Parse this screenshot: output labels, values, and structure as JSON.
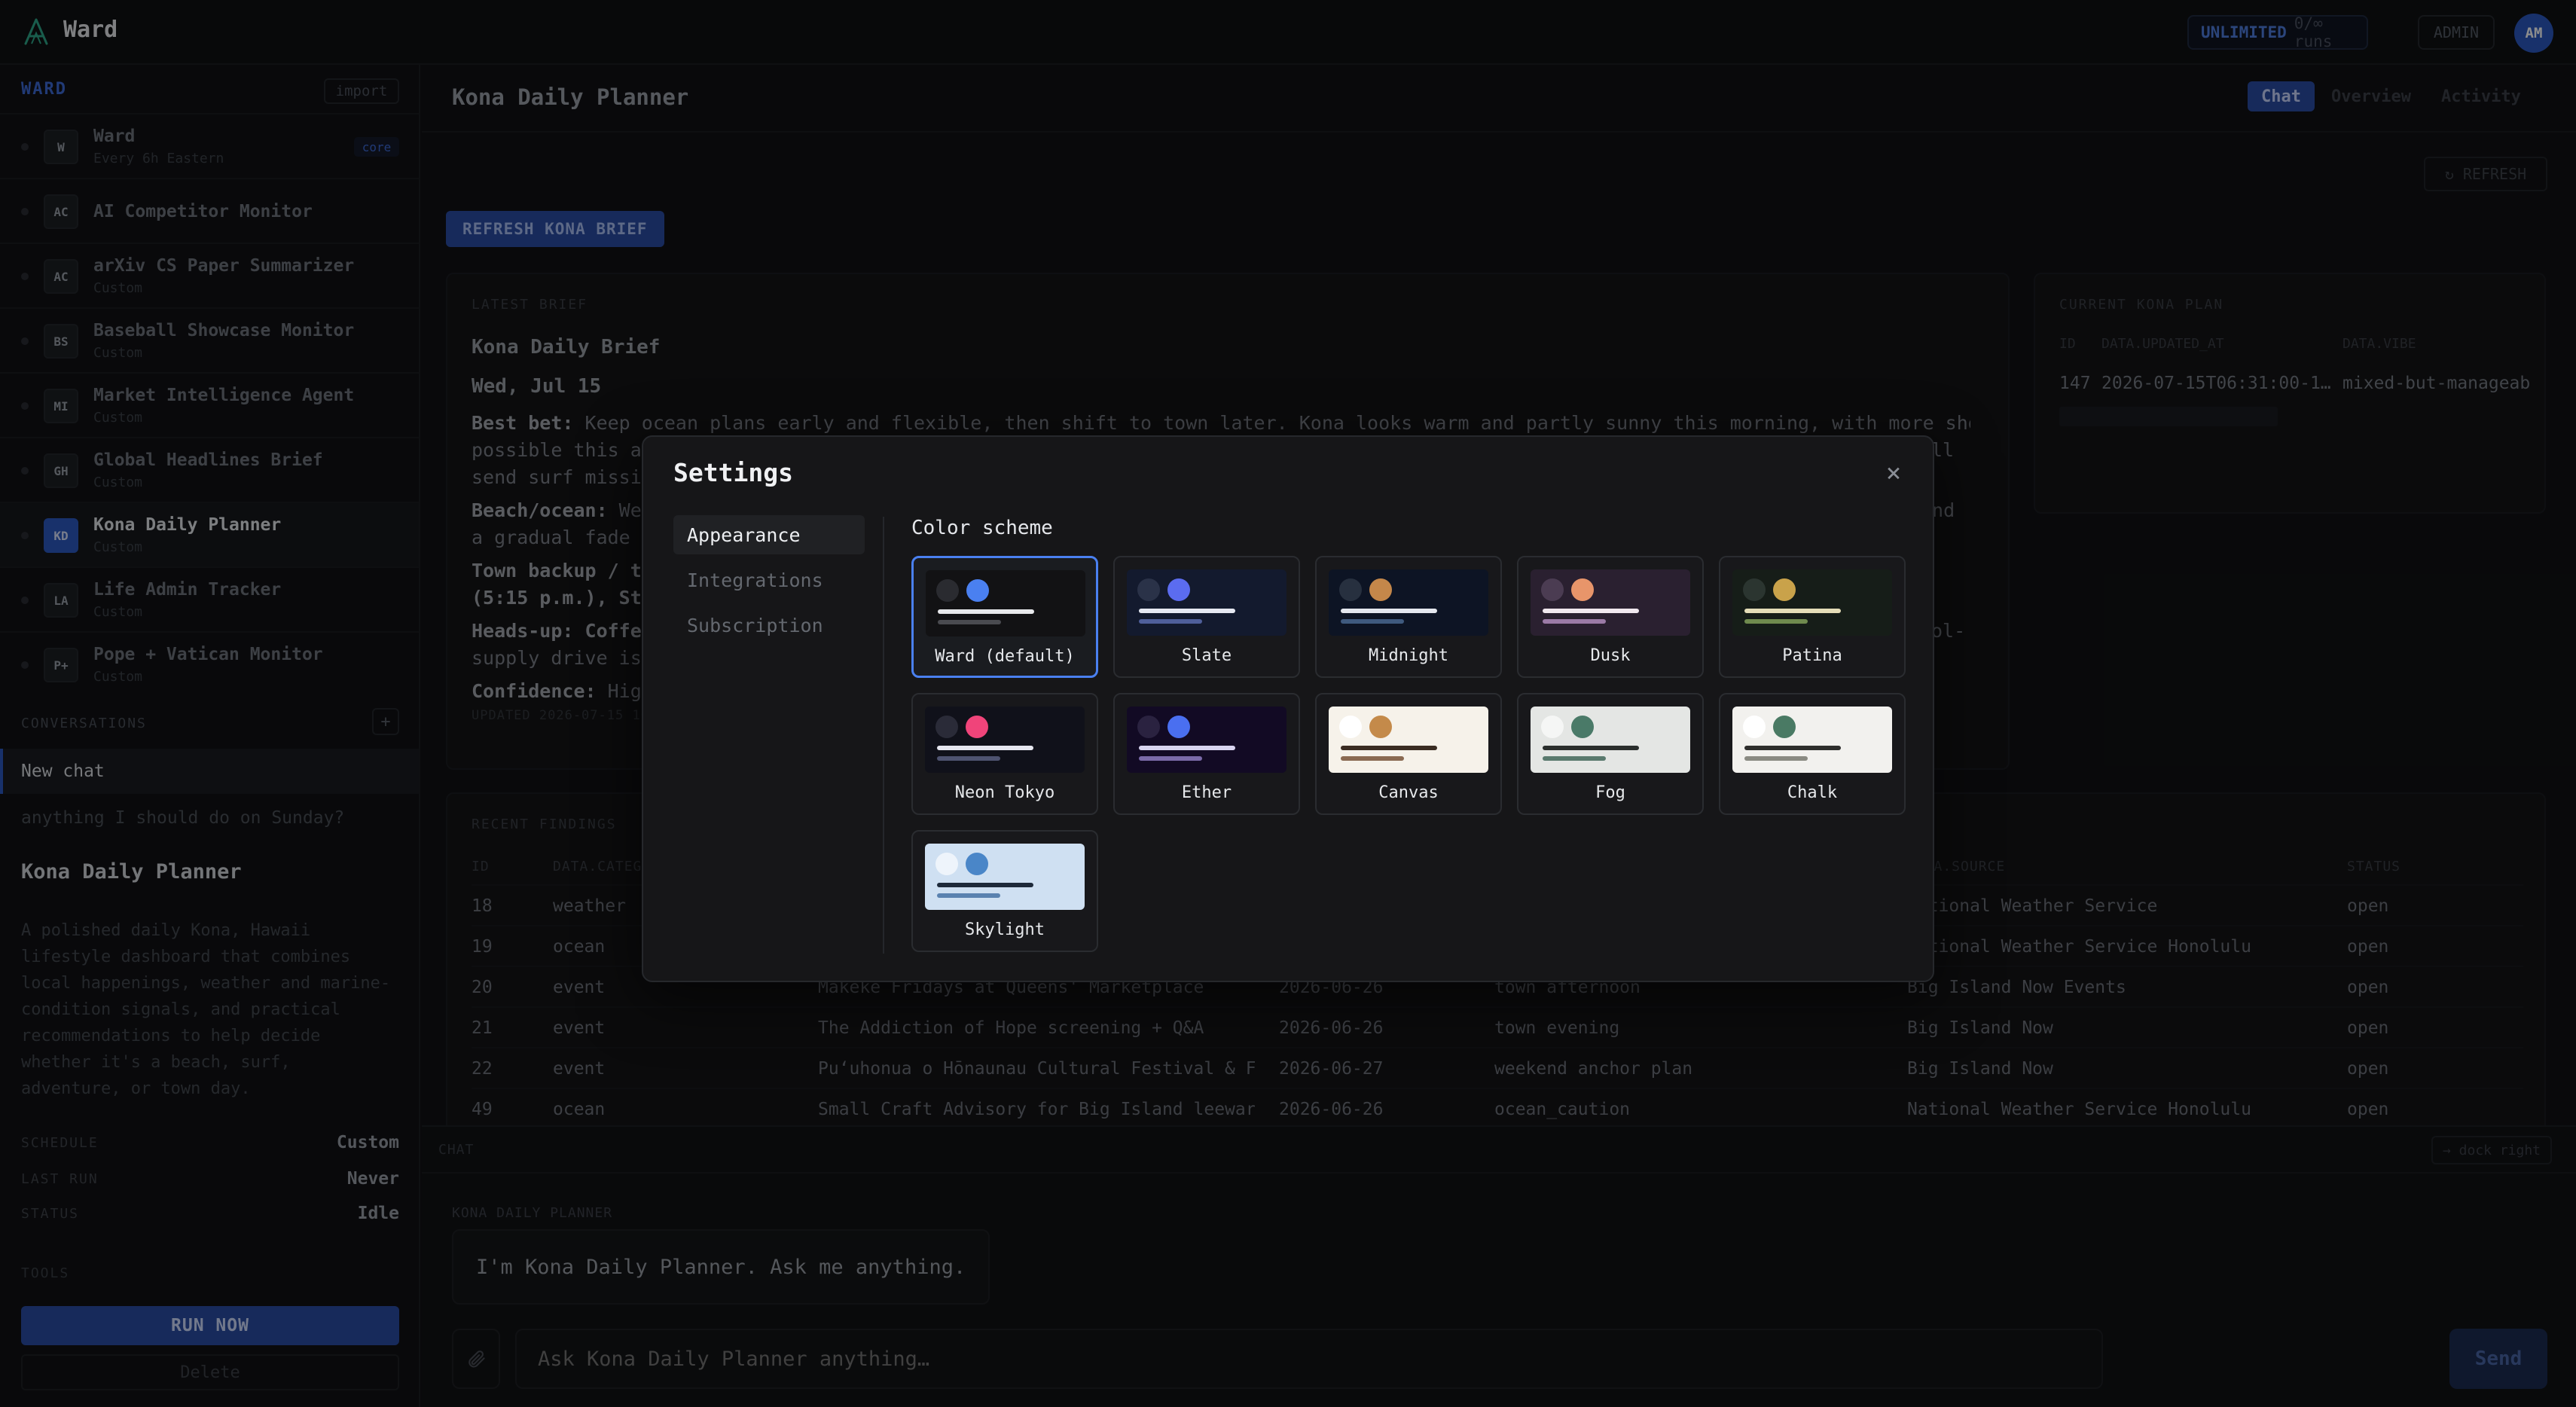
{
  "app": {
    "name": "Ward",
    "plan_label": "UNLIMITED",
    "plan_runs": "0/∞ runs",
    "admin_label": "ADMIN",
    "avatar_initials": "AM"
  },
  "sidebar": {
    "heading": "WARD",
    "import_label": "import",
    "agents": [
      {
        "badge": "W",
        "name": "Ward",
        "sub": "Every 6h Eastern",
        "tag": "core"
      },
      {
        "badge": "AC",
        "name": "AI Competitor Monitor",
        "sub": ""
      },
      {
        "badge": "AC",
        "name": "arXiv CS Paper Summarizer",
        "sub": "Custom"
      },
      {
        "badge": "BS",
        "name": "Baseball Showcase Monitor",
        "sub": "Custom"
      },
      {
        "badge": "MI",
        "name": "Market Intelligence Agent",
        "sub": "Custom"
      },
      {
        "badge": "GH",
        "name": "Global Headlines Brief",
        "sub": "Custom"
      },
      {
        "badge": "KD",
        "name": "Kona Daily Planner",
        "sub": "Custom"
      },
      {
        "badge": "LA",
        "name": "Life Admin Tracker",
        "sub": "Custom"
      },
      {
        "badge": "P+",
        "name": "Pope + Vatican Monitor",
        "sub": "Custom"
      }
    ],
    "conversations_heading": "CONVERSATIONS",
    "conversations_add": "+",
    "conversations": [
      {
        "label": "New chat"
      },
      {
        "label": "anything I should do on Sunday?"
      }
    ],
    "agent_title": "Kona Daily Planner",
    "agent_description": "A polished daily Kona, Hawaii lifestyle dashboard that combines local happenings, weather and marine-condition signals, and practical recommendations to help decide whether it's a beach, surf, adventure, or town day.",
    "meta": [
      {
        "key": "SCHEDULE",
        "value": "Custom"
      },
      {
        "key": "LAST RUN",
        "value": "Never"
      },
      {
        "key": "STATUS",
        "value": "Idle"
      }
    ],
    "tools_heading": "TOOLS",
    "run_label": "RUN NOW",
    "delete_label": "Delete"
  },
  "main": {
    "title": "Kona Daily Planner",
    "tabs": [
      {
        "label": "Chat"
      },
      {
        "label": "Overview"
      },
      {
        "label": "Activity"
      }
    ],
    "refresh_label": "↻ REFRESH",
    "refresh_brief_label": "REFRESH KONA BRIEF",
    "latest_brief": {
      "label": "LATEST BRIEF",
      "title": "Kona Daily Brief",
      "date": "Wed, Jul 15",
      "paragraphs": [
        {
          "lead": "Best bet:",
          "text": " Keep ocean plans early and flexible, then shift to town later. Kona looks warm and partly sunny this morning, with more showers"
        },
        {
          "lead": "",
          "text": "possible this af"
        },
        {
          "lead": "",
          "text": "send surf missio"
        },
        {
          "lead": "Beach/ocean:",
          "text": " Wes"
        },
        {
          "lead": "",
          "text": "a gradual fade a"
        },
        {
          "lead": "Town backup / to",
          "text": ""
        },
        {
          "lead": "(5:15 p.m.), Sta",
          "text": ""
        },
        {
          "lead": "Heads-up: Coffee",
          "text": ""
        },
        {
          "lead": "",
          "text": "supply drive is"
        },
        {
          "lead": "Confidence:",
          "text": " High"
        }
      ],
      "right_fragments": [
        "ll",
        "and",
        "ol-"
      ],
      "updated": "UPDATED 2026-07-15 16:"
    },
    "current_plan": {
      "label": "CURRENT KONA PLAN",
      "columns": [
        "ID",
        "DATA.UPDATED_AT",
        "DATA.VIBE"
      ],
      "row": [
        "147",
        "2026-07-15T06:31:00-1…",
        "mixed-but-manageab"
      ]
    },
    "recent_findings": {
      "label": "RECENT FINDINGS",
      "columns": [
        "ID",
        "DATA.CATEG",
        "DATA.SOURCE",
        "STATUS"
      ],
      "rows": [
        [
          "18",
          "weather",
          "",
          "",
          "",
          "National Weather Service",
          "open"
        ],
        [
          "19",
          "ocean",
          "",
          "",
          "",
          "National Weather Service Honolulu",
          "open"
        ],
        [
          "20",
          "event",
          "Makeke Fridays at Queens' Marketplace",
          "2026-06-26",
          "town afternoon",
          "Big Island Now Events",
          "open"
        ],
        [
          "21",
          "event",
          "The Addiction of Hope screening + Q&A",
          "2026-06-26",
          "town evening",
          "Big Island Now",
          "open"
        ],
        [
          "22",
          "event",
          "Puʻuhonua o Hōnaunau Cultural Festival & Fe…",
          "2026-06-27",
          "weekend anchor plan",
          "Big Island Now",
          "open"
        ],
        [
          "49",
          "ocean",
          "Small Craft Advisory for Big Island leeward…",
          "2026-06-26",
          "ocean_caution",
          "National Weather Service Honolulu",
          "open"
        ]
      ]
    }
  },
  "chat": {
    "label": "CHAT",
    "dock_label": "→ dock right",
    "sender": "KONA DAILY PLANNER",
    "message": "I'm Kona Daily Planner. Ask me anything.",
    "input_placeholder": "Ask Kona Daily Planner anything…",
    "send_label": "Send"
  },
  "settings": {
    "title": "Settings",
    "close_icon": "×",
    "nav": [
      {
        "label": "Appearance"
      },
      {
        "label": "Integrations"
      },
      {
        "label": "Subscription"
      }
    ],
    "section_title": "Color scheme",
    "selected_scheme": "Ward (default)",
    "schemes": [
      {
        "label": "Ward (default)",
        "bg": "#121214",
        "c1": "#2a2b30",
        "c2": "#4a80f0",
        "l1": "#e8e9ec",
        "l2": "#4a4b50"
      },
      {
        "label": "Slate",
        "bg": "#131a2e",
        "c1": "#2a3248",
        "c2": "#5b6cf0",
        "l1": "#e6e9f2",
        "l2": "#4f5f9a"
      },
      {
        "label": "Midnight",
        "bg": "#0d1424",
        "c1": "#27303f",
        "c2": "#c4874a",
        "l1": "#e4e7ee",
        "l2": "#3f5a7e"
      },
      {
        "label": "Dusk",
        "bg": "#2a2030",
        "c1": "#4b3c52",
        "c2": "#e8956a",
        "l1": "#f1e8ef",
        "l2": "#9b7aa6"
      },
      {
        "label": "Patina",
        "bg": "#161d18",
        "c1": "#2b3530",
        "c2": "#c9a24a",
        "l1": "#e5ddb8",
        "l2": "#6f8a4e"
      },
      {
        "label": "Neon Tokyo",
        "bg": "#10111a",
        "c1": "#2a2b38",
        "c2": "#f0447a",
        "l1": "#e6e7f0",
        "l2": "#4e5370"
      },
      {
        "label": "Ether",
        "bg": "#120a24",
        "c1": "#2a2240",
        "c2": "#4a6ff0",
        "l1": "#d8d4f0",
        "l2": "#7a6aa8"
      },
      {
        "label": "Canvas",
        "bg": "#f6f2ea",
        "c1": "#ffffff",
        "c2": "#c48a4a",
        "l1": "#3a2c22",
        "l2": "#8a6a52"
      },
      {
        "label": "Fog",
        "bg": "#e4e6e4",
        "c1": "#f5f6f5",
        "c2": "#4a7a68",
        "l1": "#2a2e2c",
        "l2": "#5a7a6e"
      },
      {
        "label": "Chalk",
        "bg": "#f2f1ee",
        "c1": "#ffffff",
        "c2": "#4a7a64",
        "l1": "#2e2e2c",
        "l2": "#8a8a82"
      },
      {
        "label": "Skylight",
        "bg": "#cfe0f2",
        "c1": "#eef4fb",
        "c2": "#4a86c8",
        "l1": "#1e2a3a",
        "l2": "#5a82b0"
      }
    ]
  }
}
